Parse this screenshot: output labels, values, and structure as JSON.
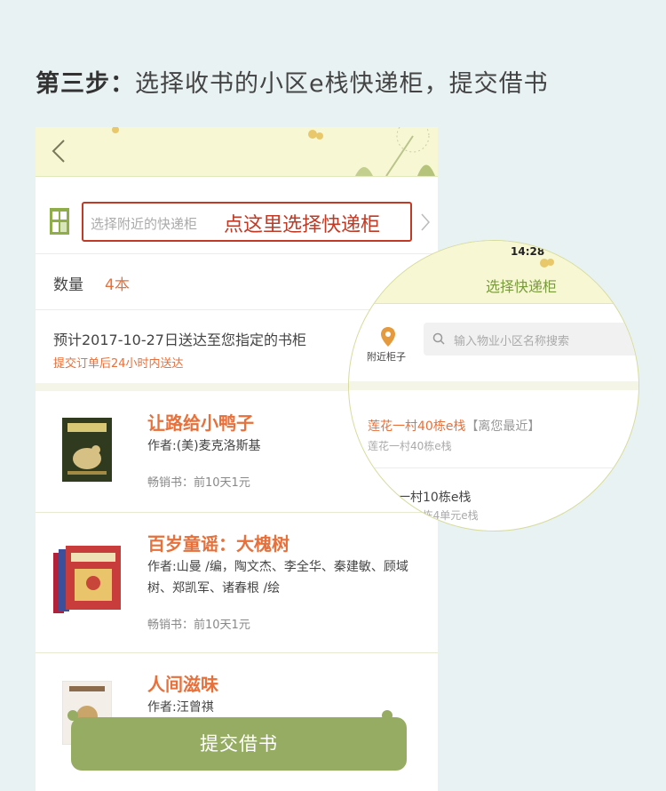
{
  "step": {
    "bold": "第三步：",
    "text": "选择收书的小区e栈快递柜，提交借书"
  },
  "cabinet": {
    "placeholder": "选择附近的快递柜",
    "hint": "点这里选择快递柜"
  },
  "quantity": {
    "label": "数量",
    "value": "4本"
  },
  "delivery": {
    "main": "预计2017-10-27日送达至您指定的书柜",
    "sub": "提交订单后24小时内送达"
  },
  "books": [
    {
      "title": "让路给小鸭子",
      "author": "作者:(美)麦克洛斯基",
      "sales": "畅销书：前10天1元"
    },
    {
      "title": "百岁童谣：大槐树",
      "author": "作者:山曼 /编，陶文杰、李全华、秦建敏、顾域树、郑凯军、诸春根 /绘",
      "sales": "畅销书：前10天1元"
    },
    {
      "title": "人间滋味",
      "author": "作者:汪曾祺"
    }
  ],
  "submit": {
    "label": "提交借书"
  },
  "magnifier": {
    "time": "14:28",
    "title": "选择快递柜",
    "nearby": "附近柜子",
    "search_placeholder": "输入物业小区名称搜索",
    "results": [
      {
        "name": "莲花一村40栋e栈",
        "tag": "【离您最近】",
        "address": "莲花一村40栋e栈"
      },
      {
        "name": "一村10栋e栈",
        "address": "0栋4单元e栈"
      }
    ]
  },
  "colors": {
    "accent": "#e8703a",
    "primary_green": "#96ac63",
    "highlight_red": "#c13a25",
    "header_bg": "#f7f7d4"
  }
}
